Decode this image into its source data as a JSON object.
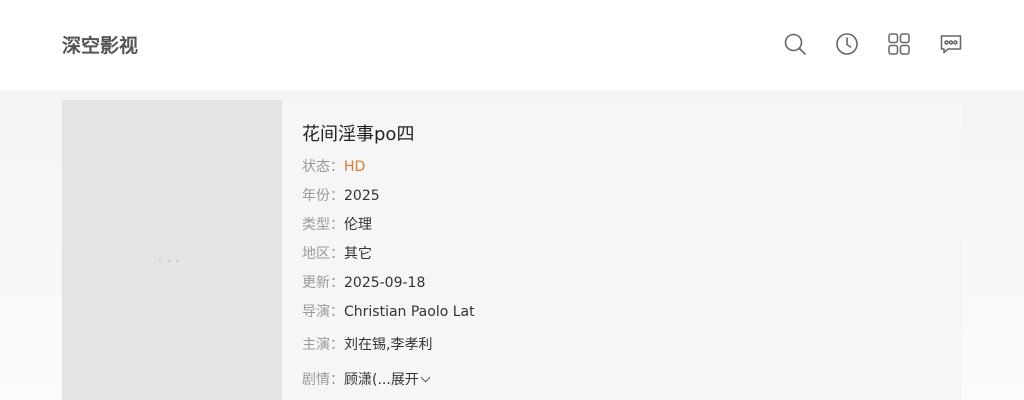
{
  "site": {
    "title": "深空影视"
  },
  "header_icons": [
    {
      "name": "search-icon"
    },
    {
      "name": "history-icon"
    },
    {
      "name": "grid-icon"
    },
    {
      "name": "message-icon"
    }
  ],
  "colors": {
    "accent": "#e0792c",
    "label": "#999999",
    "text": "#333333"
  },
  "movie": {
    "title": "花间淫事po四",
    "fields": [
      {
        "label": "状态：",
        "value": "HD"
      },
      {
        "label": "年份：",
        "value": "2025"
      },
      {
        "label": "类型：",
        "value": "伦理"
      },
      {
        "label": "地区：",
        "value": "其它"
      },
      {
        "label": "更新：",
        "value": "2025-09-18"
      },
      {
        "label": "导演：",
        "value": "Christian Paolo Lat"
      },
      {
        "label": "主演：",
        "value": "刘在锡,李孝利"
      },
      {
        "label": "剧情：",
        "value": "顾潇(..."
      }
    ],
    "expand_label": "展开"
  }
}
